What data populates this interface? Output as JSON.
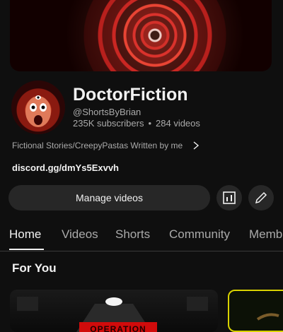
{
  "channel": {
    "name": "DoctorFiction",
    "handle": "@ShortsByBrian",
    "subscribers": "235K subscribers",
    "separator": "•",
    "videos": "284 videos",
    "description": "Fictional Stories/CreepyPastas Written by me",
    "link": "discord.gg/dmYs5Exvvh"
  },
  "actions": {
    "manage_label": "Manage videos"
  },
  "tabs": [
    {
      "label": "Home",
      "active": true
    },
    {
      "label": "Videos",
      "active": false
    },
    {
      "label": "Shorts",
      "active": false
    },
    {
      "label": "Community",
      "active": false
    },
    {
      "label": "Memb",
      "active": false
    }
  ],
  "section": {
    "title": "For You"
  },
  "thumbnails": [
    {
      "overlay_text": "OPERATION"
    },
    {
      "overlay_text": ""
    }
  ],
  "colors": {
    "background": "#0f0f0f",
    "button_bg": "#272727",
    "secondary_text": "#aaaaaa",
    "thumb_border": "#d9d300"
  },
  "icons": [
    "analytics-icon",
    "edit-pencil-icon",
    "chevron-right-icon"
  ]
}
